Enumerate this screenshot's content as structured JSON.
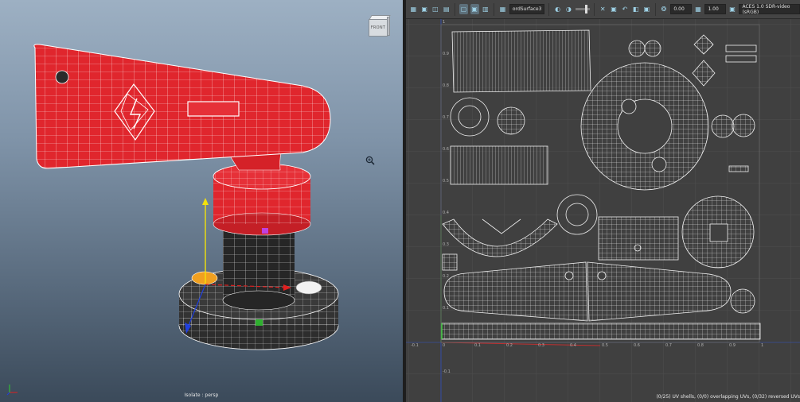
{
  "viewport": {
    "camera_label": "Isolate : persp",
    "viewcube_label": "FRONT"
  },
  "uv_editor": {
    "toolbar": {
      "shape_name": "ordSurface3",
      "value_a": "0.00",
      "value_b": "1.00",
      "color_space": "ACES 1.0 SDR-video (sRGB)"
    },
    "status": "(0/25) UV shells, (0/0) overlapping UVs, (0/32) reversed UVs",
    "axis_ticks_x": [
      "-0.1",
      "0",
      "0.1",
      "0.2",
      "0.3",
      "0.4",
      "0.5",
      "0.6",
      "0.7",
      "0.8",
      "0.9",
      "1"
    ],
    "axis_ticks_y": [
      "1",
      "0.9",
      "0.8",
      "0.7",
      "0.6",
      "0.5",
      "0.4",
      "0.3",
      "0.2",
      "0.1",
      "-0.1"
    ]
  },
  "icons": {
    "viewcube": "viewcube-icon",
    "zoom": "zoom-icon",
    "axis": "axis-gizmo-icon"
  },
  "colors": {
    "mesh_red": "#e0262d",
    "mesh_dark": "#2e2e2e",
    "wire": "#ffffff",
    "uv_grid": "#4c4c4c"
  }
}
